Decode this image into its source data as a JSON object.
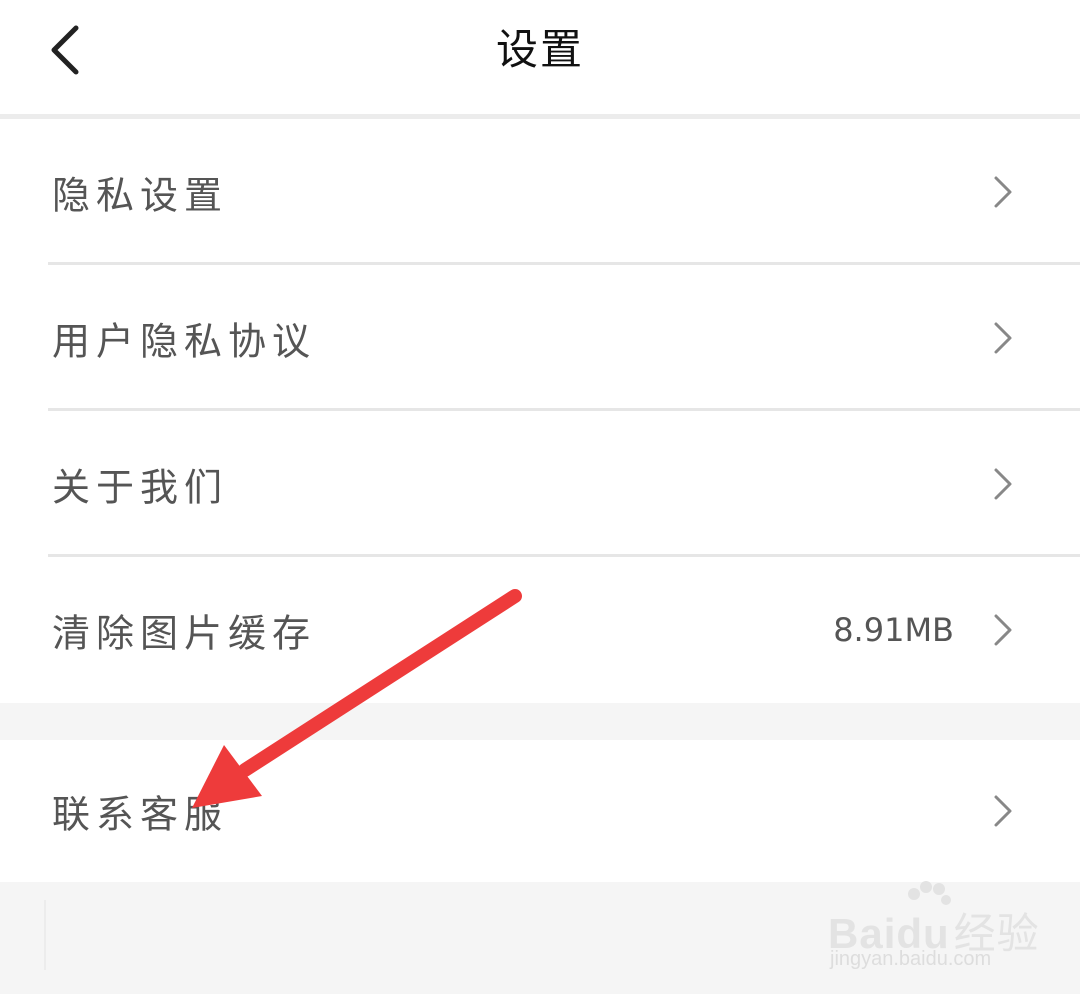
{
  "header": {
    "title": "设置",
    "back_icon": "chevron-left-icon"
  },
  "settings": {
    "items": [
      {
        "label": "隐私设置",
        "value": "",
        "icon": "chevron-right-icon"
      },
      {
        "label": "用户隐私协议",
        "value": "",
        "icon": "chevron-right-icon"
      },
      {
        "label": "关于我们",
        "value": "",
        "icon": "chevron-right-icon"
      },
      {
        "label": "清除图片缓存",
        "value": "8.91MB",
        "icon": "chevron-right-icon"
      },
      {
        "label": "联系客服",
        "value": "",
        "icon": "chevron-right-icon"
      }
    ]
  },
  "watermark": {
    "brand_latin": "Bai",
    "brand_latin2": "du",
    "brand_cn": "经验",
    "url": "jingyan.baidu.com"
  },
  "colors": {
    "background": "#f5f5f5",
    "surface": "#ffffff",
    "divider": "#e6e6e6",
    "text": "#555555",
    "title_text": "#111111",
    "chevron": "#888888",
    "annotation": "#ee3b3b"
  }
}
